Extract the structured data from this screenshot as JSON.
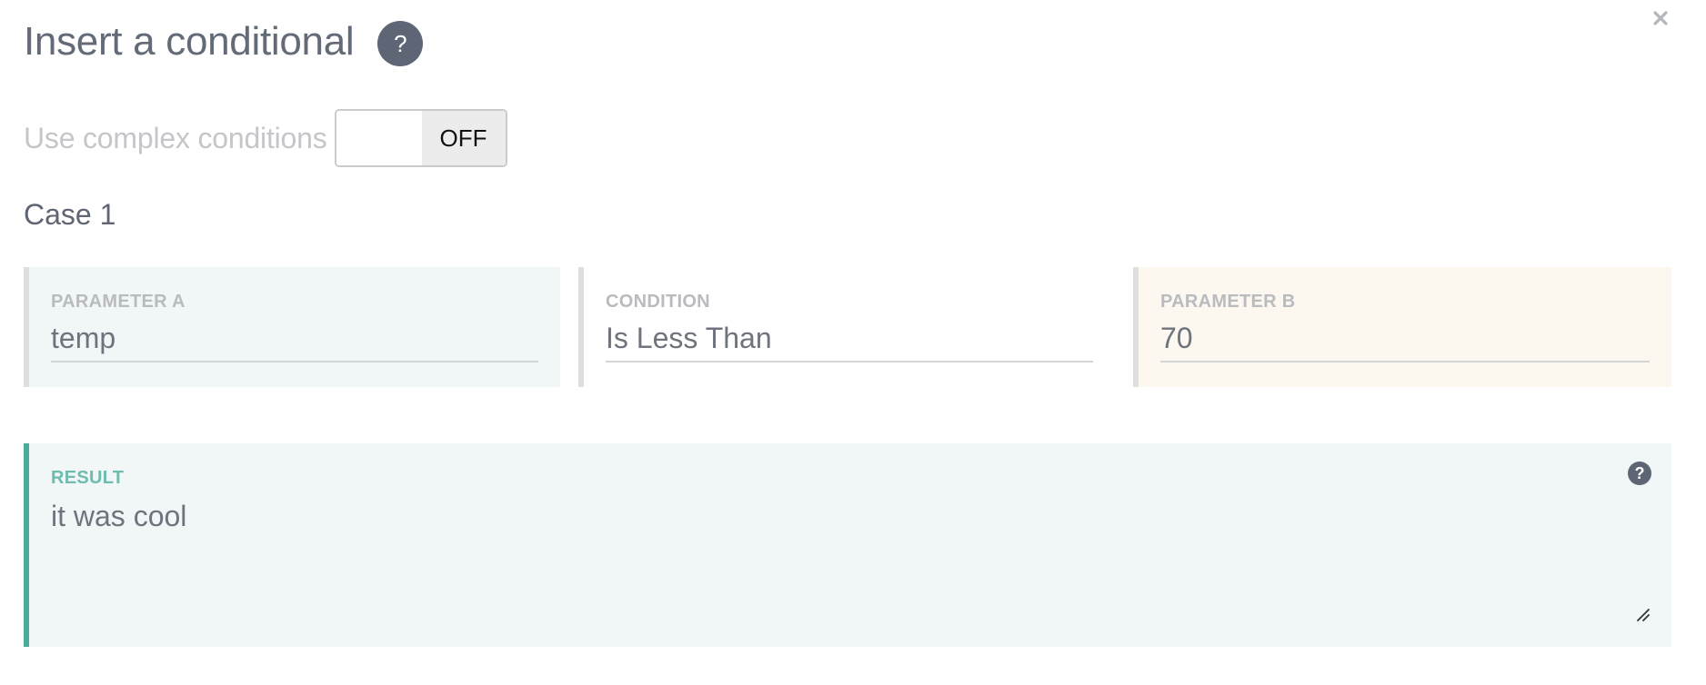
{
  "dialog": {
    "title": "Insert a conditional",
    "help_glyph": "?",
    "close_icon": "close-icon"
  },
  "complex": {
    "label": "Use complex conditions",
    "state": "OFF"
  },
  "case": {
    "title": "Case 1",
    "parameter_a": {
      "label": "PARAMETER A",
      "value": "temp"
    },
    "condition": {
      "label": "CONDITION",
      "value": "Is Less Than"
    },
    "parameter_b": {
      "label": "PARAMETER B",
      "value": "70"
    },
    "result": {
      "label": "RESULT",
      "value": "it was cool",
      "help_glyph": "?"
    }
  },
  "colors": {
    "accent": "#4aab99",
    "help_bg": "#5e6676",
    "param_a_bg": "#f1f7f6",
    "param_b_bg": "#fcf7ef"
  }
}
